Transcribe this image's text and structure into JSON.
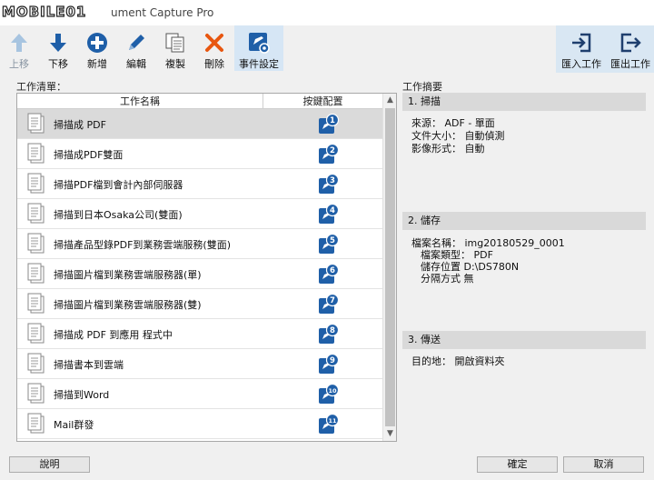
{
  "window": {
    "watermark": "MOBILE01",
    "title": "ument Capture Pro"
  },
  "toolbar": {
    "items": [
      {
        "label": "上移",
        "icon": "arrow-up-icon",
        "state": "disabled"
      },
      {
        "label": "下移",
        "icon": "arrow-down-icon",
        "state": "normal"
      },
      {
        "label": "新增",
        "icon": "plus-circle-icon",
        "state": "normal"
      },
      {
        "label": "編輯",
        "icon": "pencil-icon",
        "state": "normal"
      },
      {
        "label": "複製",
        "icon": "copy-icon",
        "state": "normal"
      },
      {
        "label": "刪除",
        "icon": "delete-x-icon",
        "state": "normal"
      },
      {
        "label": "事件設定",
        "icon": "event-settings-icon",
        "state": "active"
      }
    ],
    "right_items": [
      {
        "label": "匯入工作",
        "icon": "import-icon"
      },
      {
        "label": "匯出工作",
        "icon": "export-icon"
      }
    ]
  },
  "job_list": {
    "label": "工作清單：",
    "columns": {
      "name": "工作名稱",
      "button": "按鍵配置"
    },
    "rows": [
      {
        "name": "掃描成 PDF",
        "button": "1",
        "selected": true
      },
      {
        "name": "掃描成PDF雙面",
        "button": "2"
      },
      {
        "name": "掃描PDF檔到會計內部伺服器",
        "button": "3"
      },
      {
        "name": "掃描到日本Osaka公司(雙面)",
        "button": "4"
      },
      {
        "name": "掃描產品型錄PDF到業務雲端服務(雙面)",
        "button": "5"
      },
      {
        "name": "掃描圖片檔到業務雲端服務器(單)",
        "button": "6"
      },
      {
        "name": "掃描圖片檔到業務雲端服務器(雙)",
        "button": "7"
      },
      {
        "name": "掃描成 PDF 到應用 程式中",
        "button": "8"
      },
      {
        "name": "掃描書本到雲端",
        "button": "9"
      },
      {
        "name": "掃描到Word",
        "button": "10"
      },
      {
        "name": "Mail群發",
        "button": "11"
      }
    ]
  },
  "summary": {
    "label": "工作摘要",
    "scan": {
      "title": "1. 掃描",
      "lines": [
        "來源： ADF - 單面",
        "文件大小： 自動偵測",
        "影像形式： 自動"
      ]
    },
    "save": {
      "title": "2. 儲存",
      "lines": [
        "檔案名稱： img20180529_0001",
        "檔案類型： PDF",
        "儲存位置 D:\\DS780N",
        "分隔方式 無"
      ]
    },
    "send": {
      "title": "3. 傳送",
      "lines": [
        "目的地： 開啟資料夾"
      ]
    }
  },
  "buttons": {
    "help": "說明",
    "ok": "確定",
    "cancel": "取消"
  },
  "colors": {
    "icon_blue": "#1f5fa8",
    "delete_orange": "#e8560f",
    "disabled": "#a7c4e0"
  }
}
